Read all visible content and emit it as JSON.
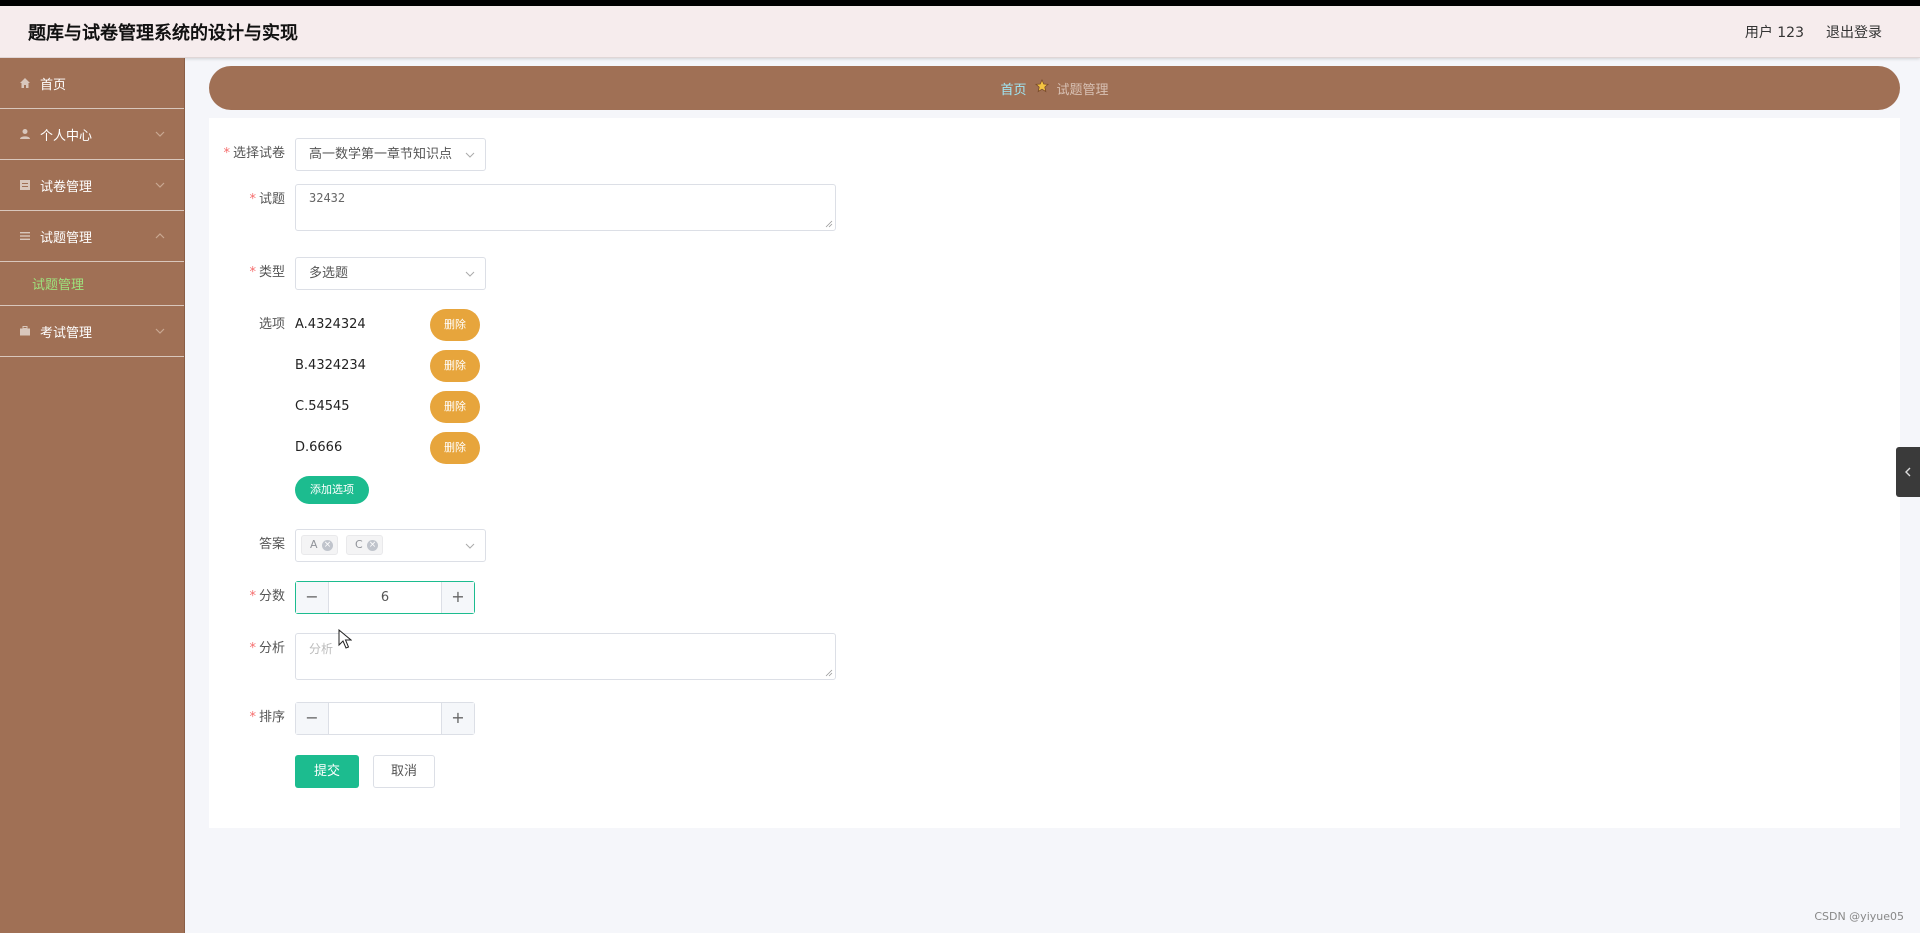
{
  "app": {
    "title": "题库与试卷管理系统的设计与实现"
  },
  "header": {
    "user": "用户 123",
    "logout": "退出登录"
  },
  "sidebar": {
    "items": [
      {
        "label": "首页",
        "icon": "home-icon"
      },
      {
        "label": "个人中心",
        "icon": "user-icon"
      },
      {
        "label": "试卷管理",
        "icon": "paper-icon"
      },
      {
        "label": "试题管理",
        "icon": "list-icon"
      },
      {
        "label": "考试管理",
        "icon": "briefcase-icon"
      }
    ],
    "submenu": {
      "label": "试题管理"
    }
  },
  "breadcrumb": {
    "home": "首页",
    "current": "试题管理"
  },
  "form": {
    "paper_label": "选择试卷",
    "paper_value": "高一数学第一章节知识点",
    "question_label": "试题",
    "question_value": "32432",
    "type_label": "类型",
    "type_value": "多选题",
    "options_label": "选项",
    "options": [
      {
        "text": "A.4324324",
        "delete": "删除"
      },
      {
        "text": "B.4324234",
        "delete": "删除"
      },
      {
        "text": "C.54545",
        "delete": "删除"
      },
      {
        "text": "D.6666",
        "delete": "删除"
      }
    ],
    "add_option": "添加选项",
    "answer_label": "答案",
    "answer_tags": [
      "A",
      "C"
    ],
    "score_label": "分数",
    "score_value": "6",
    "analysis_label": "分析",
    "analysis_placeholder": "分析",
    "order_label": "排序",
    "order_value": "",
    "submit": "提交",
    "cancel": "取消"
  },
  "watermark": "CSDN @yiyue05",
  "colors": {
    "sidebar": "#a07055",
    "primary": "#1cbc8f",
    "warning": "#e7a53c",
    "header": "#f6eced"
  }
}
